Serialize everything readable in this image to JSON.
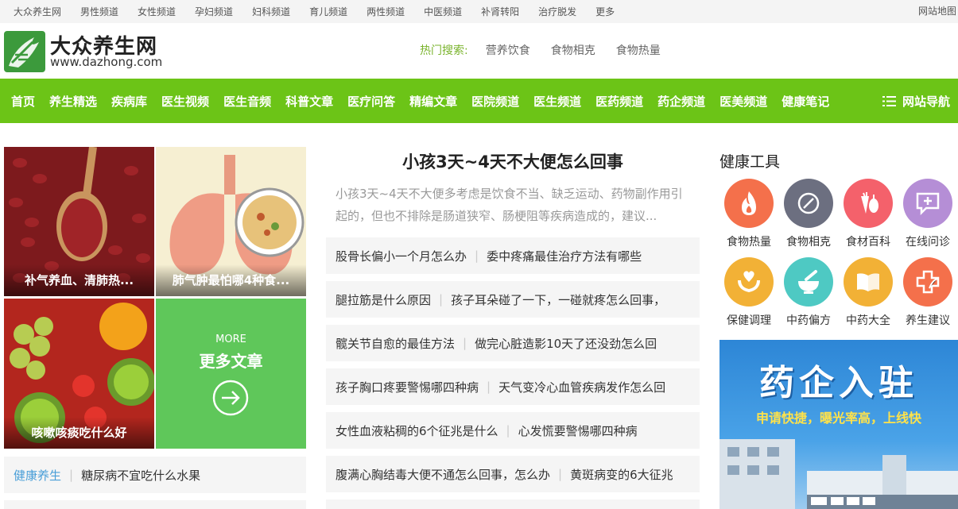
{
  "topbar": {
    "links": [
      "大众养生网",
      "男性频道",
      "女性频道",
      "孕妇频道",
      "妇科频道",
      "育儿频道",
      "两性频道",
      "中医频道",
      "补肾转阳",
      "治疗脱发",
      "更多"
    ],
    "sitemap": "网站地图"
  },
  "header": {
    "brand_name": "大众养生网",
    "brand_url": "www.dazhong.com",
    "hot_label": "热门搜索:",
    "hot_items": [
      "营养饮食",
      "食物相克",
      "食物热量"
    ]
  },
  "nav": {
    "items": [
      "首页",
      "养生精选",
      "疾病库",
      "医生视频",
      "医生音频",
      "科普文章",
      "医疗问答",
      "精编文章",
      "医院频道",
      "医生频道",
      "医药频道",
      "药企频道",
      "医美频道",
      "健康笔记"
    ],
    "site_nav": "网站导航",
    "color": "#6cc417"
  },
  "tiles": {
    "t1": "补气养血、清肺热...",
    "t2": "肺气肿最怕哪4种食...",
    "t3": "咳嗽咳痰吃什么好",
    "more_en": "MORE",
    "more_cn": "更多文章"
  },
  "left_list": {
    "category": "健康养生",
    "title": "糖尿病不宜吃什么水果"
  },
  "main": {
    "headline": "小孩3天~4天不大便怎么回事",
    "summary": "小孩3天~4天不大便多考虑是饮食不当、缺乏运动、药物副作用引起的，但也不排除是肠道狭窄、肠梗阻等疾病造成的，建议...",
    "rows": [
      [
        "股骨长偏小一个月怎么办",
        "委中疼痛最佳治疗方法有哪些"
      ],
      [
        "腿拉筋是什么原因",
        "孩子耳朵碰了一下，一碰就疼怎么回事，"
      ],
      [
        "髋关节自愈的最佳方法",
        "做完心脏造影10天了还没劲怎么回"
      ],
      [
        "孩子胸口疼要警惕哪四种病",
        "天气变冷心血管疾病发作怎么回"
      ],
      [
        "女性血液粘稠的6个征兆是什么",
        "心发慌要警惕哪四种病"
      ],
      [
        "腹满心胸结毒大便不通怎么回事，怎么办",
        "黄斑病变的6大征兆"
      ]
    ]
  },
  "tools": {
    "title": "健康工具",
    "items": [
      {
        "label": "食物热量",
        "icon": "flame-icon",
        "color": "#f4704b"
      },
      {
        "label": "食物相克",
        "icon": "forbidden-icon",
        "color": "#6c6f80"
      },
      {
        "label": "食材百科",
        "icon": "vegetables-icon",
        "color": "#f4616b"
      },
      {
        "label": "在线问诊",
        "icon": "chat-plus-icon",
        "color": "#b58ed6"
      },
      {
        "label": "保健调理",
        "icon": "care-hands-icon",
        "color": "#f2b136"
      },
      {
        "label": "中药偏方",
        "icon": "mortar-icon",
        "color": "#4ec9c3"
      },
      {
        "label": "中药大全",
        "icon": "book-icon",
        "color": "#f2b136"
      },
      {
        "label": "养生建议",
        "icon": "medical-cross-icon",
        "color": "#f4704b"
      }
    ]
  },
  "banner": {
    "title": "药企入驻",
    "subtitle": "申请快捷，曝光率高，上线快"
  }
}
